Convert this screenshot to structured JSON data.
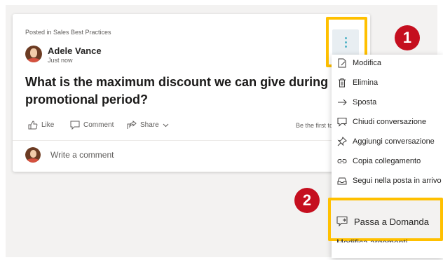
{
  "post": {
    "posted_in": "Posted in Sales Best Practices",
    "author": "Adele Vance",
    "time": "Just now",
    "question_line1": "What is the maximum discount we can give during t",
    "question_line2": "promotional period?",
    "actions": {
      "like": "Like",
      "comment": "Comment",
      "share": "Share"
    },
    "first_text": "Be the first to",
    "comment_placeholder": "Write a comment"
  },
  "badges": {
    "one": "1",
    "two": "2"
  },
  "menu": {
    "items": [
      {
        "label": "Modifica",
        "icon": "edit-icon"
      },
      {
        "label": "Elimina",
        "icon": "trash-icon"
      },
      {
        "label": "Sposta",
        "icon": "arrow-right-icon"
      },
      {
        "label": "Chiudi conversazione",
        "icon": "close-conversation-icon"
      },
      {
        "label": "Aggiungi conversazione",
        "icon": "pin-icon"
      },
      {
        "label": "Copia collegamento",
        "icon": "link-icon"
      },
      {
        "label": "Segui nella posta in arrivo",
        "icon": "inbox-icon"
      }
    ],
    "highlighted": {
      "label": "Passa a Domanda",
      "icon": "question-convert-icon"
    },
    "partial": {
      "label": "Modifica argomenti"
    }
  },
  "colors": {
    "highlight_border": "#ffc000",
    "badge": "#c50f1f",
    "kebab_dots": "#4fb3c6"
  }
}
